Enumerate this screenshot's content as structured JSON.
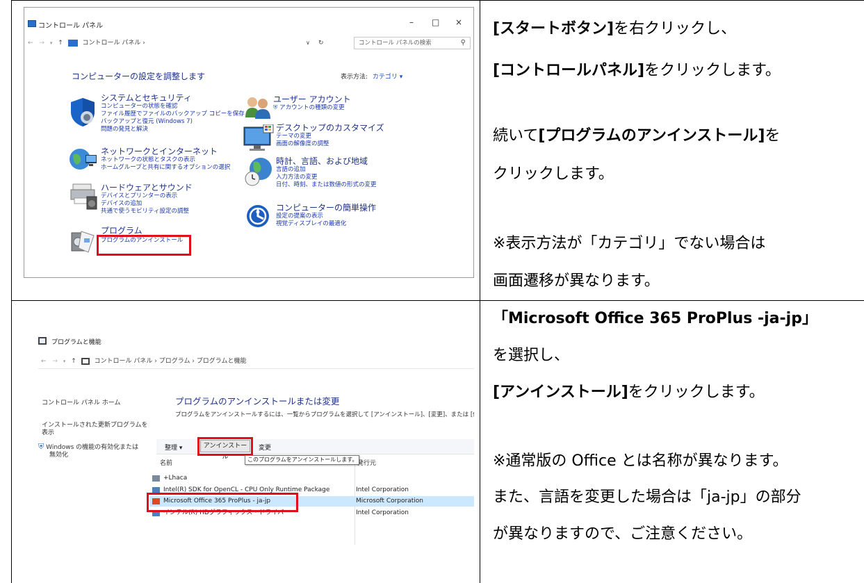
{
  "instructions": {
    "step1": {
      "line1_bold": "[スタートボタン]",
      "line1_rest": "を右クリックし、",
      "line2_bold": "[コントロールパネル]",
      "line2_rest": "をクリックします。",
      "line3_pre": "続いて",
      "line3_bold": "[プログラムのアンインストール]",
      "line3_rest": "を",
      "line4": "クリックします。",
      "note1": "※表示方法が「カテゴリ」でない場合は",
      "note2": "画面遷移が異なります。"
    },
    "step2": {
      "line1_bold": "「Microsoft Office 365 ProPlus -ja-jp」",
      "line2": "を選択し、",
      "line3_bold": "[アンインストール]",
      "line3_rest": "をクリックします。",
      "note1": "※通常版の Office とは名称が異なります。",
      "note2": "また、言語を変更した場合は「ja-jp」の部分",
      "note3": "が異なりますので、ご注意ください。"
    }
  },
  "control_panel": {
    "window_title": "コントロール パネル",
    "minimize_glyph": "–",
    "maximize_glyph": "□",
    "close_glyph": "×",
    "breadcrumb": "コントロール パネル  ›",
    "search_placeholder": "コントロール パネルの検索",
    "heading": "コンピューターの設定を調整します",
    "view_by_label": "表示方法:",
    "view_by_value": "カテゴリ ▾",
    "categories": {
      "system": {
        "title": "システムとセキュリティ",
        "links": [
          "コンピューターの状態を確認",
          "ファイル履歴でファイルのバックアップ コピーを保存",
          "バックアップと復元 (Windows 7)",
          "問題の発見と解決"
        ]
      },
      "network": {
        "title": "ネットワークとインターネット",
        "links": [
          "ネットワークの状態とタスクの表示",
          "ホームグループと共有に関するオプションの選択"
        ]
      },
      "hardware": {
        "title": "ハードウェアとサウンド",
        "links": [
          "デバイスとプリンターの表示",
          "デバイスの追加",
          "共通で使うモビリティ設定の調整"
        ]
      },
      "programs": {
        "title": "プログラム",
        "links": [
          "プログラムのアンインストール"
        ]
      },
      "users": {
        "title": "ユーザー アカウント",
        "links": [
          "アカウントの種類の変更"
        ]
      },
      "appearance": {
        "title": "デスクトップのカスタマイズ",
        "links": [
          "テーマの変更",
          "画面の解像度の調整"
        ]
      },
      "clock": {
        "title": "時計、言語、および地域",
        "links": [
          "言語の追加",
          "入力方法の変更",
          "日付、時刻、または数値の形式の変更"
        ]
      },
      "ease": {
        "title": "コンピューターの簡単操作",
        "links": [
          "設定の提案の表示",
          "視覚ディスプレイの最適化"
        ]
      }
    }
  },
  "programs_features": {
    "window_title": "プログラムと機能",
    "breadcrumb": "コントロール パネル  ›  プログラム  ›  プログラムと機能",
    "sidebar": {
      "home": "コントロール パネル ホーム",
      "updates_line1": "インストールされた更新プログラムを",
      "updates_line2": "表示",
      "features_line1": "Windows の機能の有効化または",
      "features_line2": "無効化"
    },
    "heading": "プログラムのアンインストールまたは変更",
    "description": "プログラムをアンインストールするには、一覧からプログラムを選択して [アンインストール]、[変更]、または [修",
    "toolbar": {
      "organize": "整理 ▾",
      "uninstall": "アンインストール",
      "change": "変更"
    },
    "tooltip": "このプログラムをアンインストールします。",
    "columns": {
      "name": "名前",
      "publisher": "発行元"
    },
    "rows": [
      {
        "name": "+Lhaca",
        "publisher": ""
      },
      {
        "name": "Intel(R) SDK for OpenCL - CPU Only Runtime Package",
        "publisher": "Intel Corporation"
      },
      {
        "name": "Microsoft Office 365 ProPlus - ja-jp",
        "publisher": "Microsoft Corporation"
      },
      {
        "name": "インテル(R) HDグラフィックス・ドライバー",
        "publisher": "Intel Corporation"
      }
    ]
  },
  "colors": {
    "highlight_red": "#e0101a",
    "link_blue": "#1c3aa8",
    "heading_blue": "#1e3287",
    "selection_blue": "#cce8ff"
  }
}
